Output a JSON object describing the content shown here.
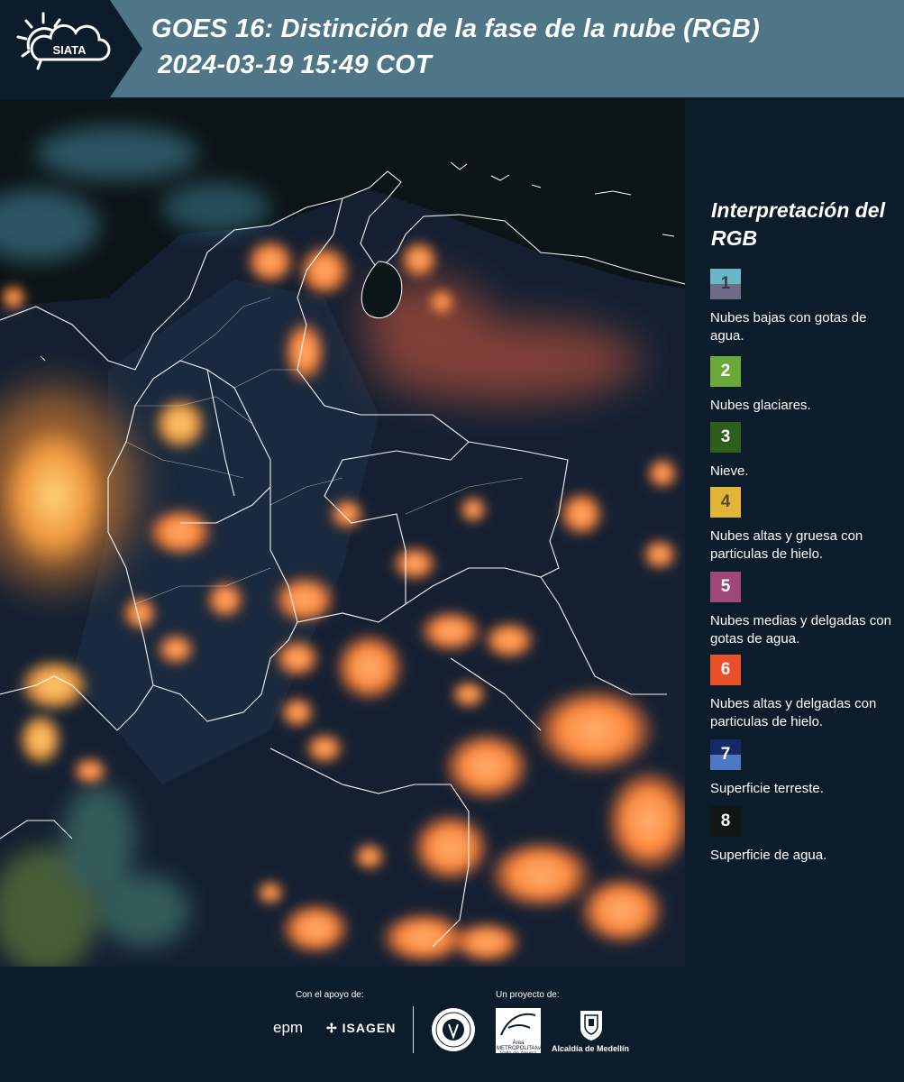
{
  "header": {
    "logo_text": "SIATA",
    "title_line1": "GOES 16: Distinción de la fase de la nube (RGB)",
    "title_line2": "2024-03-19 15:49 COT"
  },
  "legend": {
    "title": "Interpretación del RGB",
    "items": [
      {
        "number": "1",
        "label": "Nubes bajas con gotas de agua.",
        "color_top": "#6ab6c4",
        "color_bottom": "#6e6c86",
        "text_color": "#3b3b4a"
      },
      {
        "number": "2",
        "label": "Nubes glaciares.",
        "color_top": "#6aa83a",
        "color_bottom": "#6aa83a",
        "text_color": "#ffffff"
      },
      {
        "number": "3",
        "label": "Nieve.",
        "color_top": "#2f5e1c",
        "color_bottom": "#2f5e1c",
        "text_color": "#ffffff"
      },
      {
        "number": "4",
        "label": "Nubes altas y gruesa con particulas de hielo.",
        "color_top": "#e2b53a",
        "color_bottom": "#e2b53a",
        "text_color": "#5a4a2a"
      },
      {
        "number": "5",
        "label": "Nubes medias y delgadas con gotas de agua.",
        "color_top": "#a0487a",
        "color_bottom": "#a0487a",
        "text_color": "#ffffff"
      },
      {
        "number": "6",
        "label": "Nubes altas y delgadas con particulas de hielo.",
        "color_top": "#e8502a",
        "color_bottom": "#e8502a",
        "text_color": "#ffffff"
      },
      {
        "number": "7",
        "label": "Superficie terreste.",
        "color_top": "#14286a",
        "color_bottom": "#4d78c4",
        "text_color": "#ffffff"
      },
      {
        "number": "8",
        "label": "Superficie de agua.",
        "color_top": "#101714",
        "color_bottom": "#101714",
        "text_color": "#ffffff"
      }
    ]
  },
  "footer": {
    "support_label": "Con el apoyo de:",
    "project_label": "Un proyecto de:",
    "epm": "epm",
    "isagen": "ISAGEN",
    "area_metropolitana": "Área METROPOLITANA Valle de Aburrá",
    "alcaldia": "Alcaldía de Medellín"
  },
  "colors": {
    "header_bg": "#4e7687",
    "logo_tab_bg": "#0c1c2a",
    "page_bg": "#0c1c2a",
    "map_bg": "#0a1316",
    "cloud_orange": "#ff8c3c",
    "cloud_green": "#6fa888",
    "border_white": "#ffffff"
  }
}
